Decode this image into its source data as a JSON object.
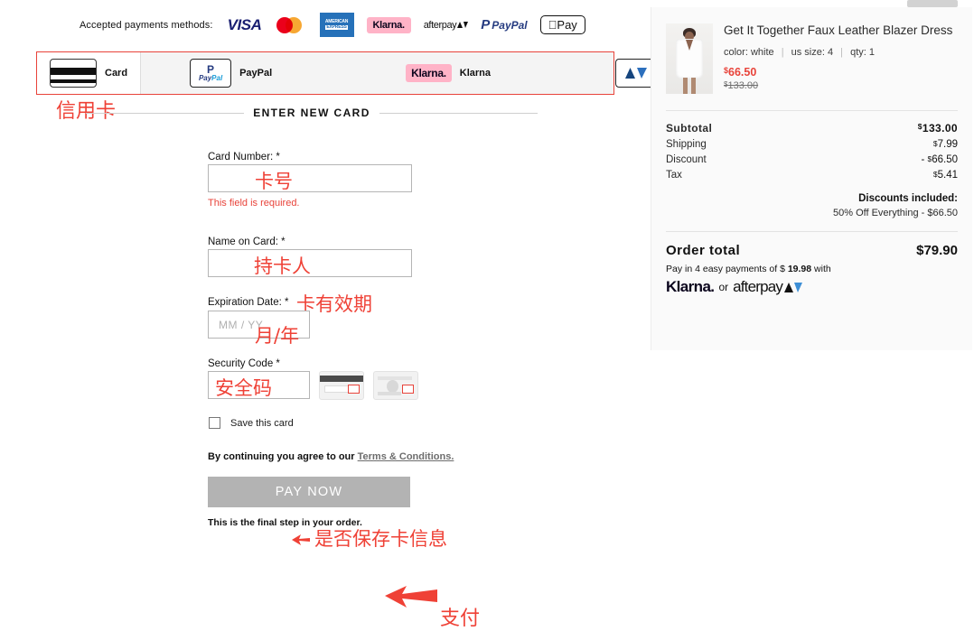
{
  "accepted": {
    "label": "Accepted payments methods:",
    "logos": [
      {
        "name": "visa-logo",
        "text": "VISA"
      },
      {
        "name": "mastercard-logo",
        "text": ""
      },
      {
        "name": "amex-logo",
        "text": "AMERICAN",
        "text2": "EXPRESS"
      },
      {
        "name": "klarna-logo",
        "text": "Klarna."
      },
      {
        "name": "afterpay-logo",
        "text": "afterpay"
      },
      {
        "name": "paypal-logo",
        "text": "PayPal"
      },
      {
        "name": "applepay-logo",
        "text": "Pay"
      }
    ]
  },
  "tabs": [
    {
      "id": "card",
      "label": "Card",
      "active": true
    },
    {
      "id": "paypal",
      "label": "PayPal",
      "active": false
    },
    {
      "id": "klarna",
      "label": "Klarna",
      "active": false
    },
    {
      "id": "afterpay",
      "label": "Afterpay",
      "active": false
    }
  ],
  "annotations": {
    "credit_card": "信用卡",
    "card_number": "卡号",
    "card_holder": "持卡人",
    "expiry": "卡有效期",
    "month_year": "月/年",
    "security_code": "安全码",
    "save_card": "是否保存卡信息",
    "pay": "支付"
  },
  "form": {
    "section_title": "ENTER NEW CARD",
    "card_number_label": "Card Number: *",
    "card_number_value": "",
    "card_number_error": "This field is required.",
    "name_label": "Name on Card: *",
    "name_value": "",
    "expiry_label": "Expiration Date:  *",
    "expiry_placeholder": "MM / YY",
    "expiry_value": "",
    "cvv_label": "Security Code *",
    "cvv_value": "",
    "save_card_label": "Save this card",
    "terms_prefix": "By continuing you agree to our ",
    "terms_link": "Terms & Conditions.",
    "pay_button": "PAY NOW",
    "final_step": "This is the final step in your order."
  },
  "summary": {
    "product": {
      "title": "Get It Together Faux Leather Blazer Dress",
      "color_label": "color: white",
      "size_label": "us size: 4",
      "qty_label": "qty: 1",
      "price_now": "66.50",
      "price_old": "133.00",
      "currency": "$"
    },
    "totals": [
      {
        "label": "Subtotal",
        "value": "133.00",
        "currency": "$",
        "bold": true,
        "prefix": ""
      },
      {
        "label": "Shipping",
        "value": "7.99",
        "currency": "$",
        "bold": false,
        "prefix": ""
      },
      {
        "label": "Discount",
        "value": "66.50",
        "currency": "$",
        "bold": false,
        "prefix": "- "
      },
      {
        "label": "Tax",
        "value": "5.41",
        "currency": "$",
        "bold": false,
        "prefix": ""
      }
    ],
    "discounts_heading": "Discounts included:",
    "discount_line": "50% Off Everything - $66.50",
    "order_total_label": "Order total",
    "order_total_value": "$79.90",
    "installments_text_a": "Pay in 4 easy payments of $ ",
    "installments_amount": "19.98",
    "installments_text_b": " with",
    "bnpl_klarna": "Klarna.",
    "bnpl_or": "or",
    "bnpl_afterpay": "afterpay"
  },
  "colors": {
    "annotation_red": "#ef4136",
    "error_red": "#e8433a",
    "klarna_pink": "#ffb3c7",
    "paypal_blue": "#253b80",
    "visa_navy": "#1a1f71",
    "amex_blue": "#2671b9",
    "pay_button_grey": "#b3b3b3"
  }
}
